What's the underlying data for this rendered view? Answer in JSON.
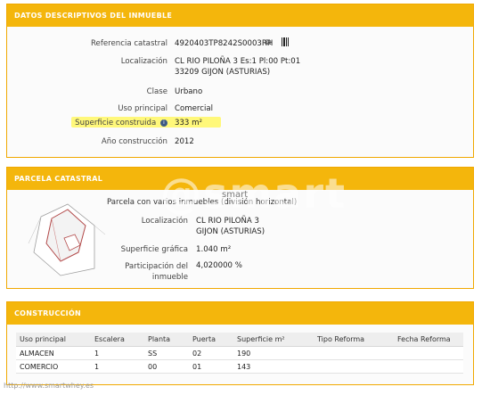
{
  "panels": {
    "datos": {
      "title": "DATOS DESCRIPTIVOS DEL INMUEBLE",
      "referencia_label": "Referencia catastral",
      "referencia_value": "4920403TP8242S0003RH",
      "localizacion_label": "Localización",
      "localizacion_line1": "CL RIO PILOÑA 3 Es:1 Pl:00 Pt:01",
      "localizacion_line2": "33209 GIJON (ASTURIAS)",
      "clase_label": "Clase",
      "clase_value": "Urbano",
      "uso_label": "Uso principal",
      "uso_value": "Comercial",
      "superficie_label": "Superficie construida",
      "superficie_value": "333 m²",
      "anio_label": "Año construcción",
      "anio_value": "2012"
    },
    "parcela": {
      "title": "PARCELA CATASTRAL",
      "subtitle": "Parcela con varios inmuebles (división horizontal)",
      "localizacion_label": "Localización",
      "localizacion_line1": "CL RIO PILOÑA 3",
      "localizacion_line2": "GIJON (ASTURIAS)",
      "superficie_label": "Superficie gráfica",
      "superficie_value": "1.040 m²",
      "participacion_label_1": "Participación del",
      "participacion_label_2": "inmueble",
      "participacion_value": "4,020000 %"
    },
    "construccion": {
      "title": "CONSTRUCCIÓN",
      "headers": [
        "Uso principal",
        "Escalera",
        "Planta",
        "Puerta",
        "Superficie m²",
        "Tipo Reforma",
        "Fecha Reforma"
      ],
      "rows": [
        [
          "ALMACEN",
          "1",
          "SS",
          "02",
          "190",
          "",
          ""
        ],
        [
          "COMERCIO",
          "1",
          "00",
          "01",
          "143",
          "",
          ""
        ]
      ]
    }
  },
  "watermark": {
    "big": "@smart",
    "small": "smart"
  },
  "footer_url": "http://www.smartwhey.es",
  "icons": [
    "copy-icon",
    "barcode-icon",
    "info-icon"
  ],
  "colors": {
    "header": "#f4b60c",
    "highlight": "#fff87a",
    "info_dot": "#3d5a84"
  }
}
